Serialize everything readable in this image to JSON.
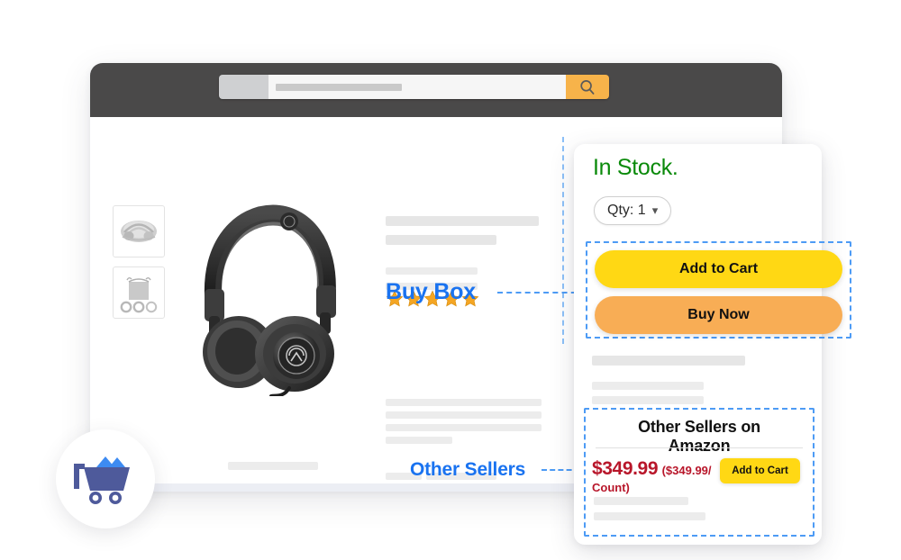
{
  "browser": {
    "search": {
      "department_label": "",
      "placeholder": "",
      "search_icon": "search-icon",
      "button_color": "#f7b34a"
    }
  },
  "product": {
    "thumbnails": [
      {
        "name": "headphones-folded-thumbnail"
      },
      {
        "name": "pouch-and-cables-thumbnail"
      }
    ],
    "hero_image_name": "over-ear-headphones-photo",
    "rating": {
      "stars_filled": 5,
      "star_color": "#f5a623"
    }
  },
  "annotations": {
    "buy_box_label": "Buy Box",
    "other_sellers_label": "Other Sellers",
    "accent_color": "#1a73f0",
    "dash_color": "#4d9bf5"
  },
  "buy_box": {
    "availability": "In Stock.",
    "availability_color": "#0a8a0a",
    "quantity_label": "Qty: 1",
    "quantity_chevron": "chevron-down-icon",
    "add_to_cart_label": "Add to Cart",
    "buy_now_label": "Buy Now",
    "add_to_cart_color": "#ffd814",
    "buy_now_color": "#f8ad55"
  },
  "other_sellers": {
    "title": "Other Sellers on Amazon",
    "price": "$349.99",
    "price_per_unit": "($349.99/ Count)",
    "price_color": "#b8162a",
    "add_to_cart_label": "Add to Cart"
  },
  "logo": {
    "name": "mining-cart-logo",
    "cart_color": "#4e5a9b",
    "peaks_color": "#3d8bf2"
  }
}
